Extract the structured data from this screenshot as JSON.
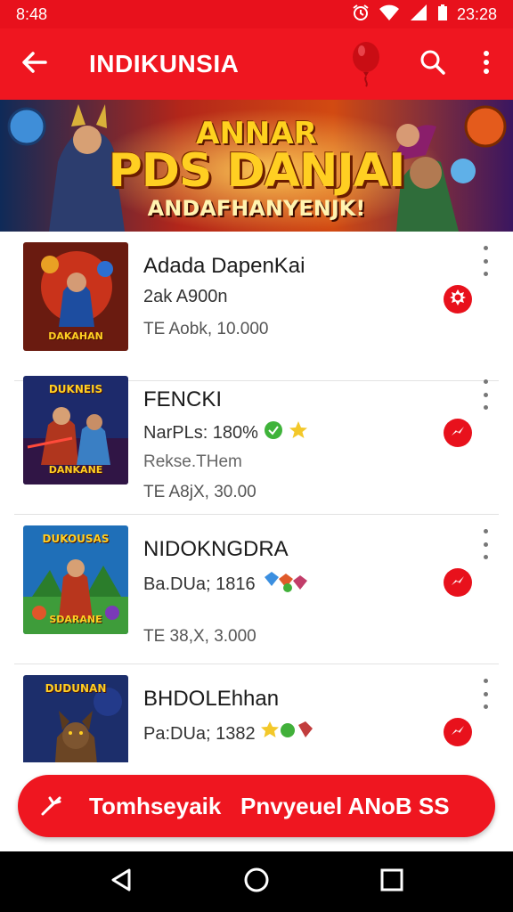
{
  "status": {
    "time": "8:48",
    "clock": "23:28"
  },
  "app_bar": {
    "title": "INDIKUNSIA"
  },
  "banner": {
    "line1": "ANNAR",
    "line2": "PDS DANJAI",
    "line3": "ANDAFHANYENJK!"
  },
  "items": [
    {
      "title": "Adada DapenKai",
      "meta1": "2ak A900n",
      "meta2": "",
      "price": "TE Aobk, 10.000",
      "thumb_top": "",
      "thumb_bottom": "DAKAHAN",
      "colors": [
        "#6a1b10",
        "#c9331b",
        "#1d1030"
      ]
    },
    {
      "title": "FENCKI",
      "meta1": "NarPLs: 180%",
      "meta2": "Rekse.THem",
      "price": "TE A8jX, 30.00",
      "thumb_top": "DUKNEIS",
      "thumb_bottom": "DANKANE",
      "colors": [
        "#1d2a6b",
        "#b0361e",
        "#301545"
      ]
    },
    {
      "title": "NIDOKNGDRA",
      "meta1": "Ba.DUa; 1816",
      "meta2": "",
      "price": "TE 38,X, 3.000",
      "thumb_top": "DUKOUSAS",
      "thumb_bottom": "SDARANE",
      "colors": [
        "#1f6fb8",
        "#3e9c3a",
        "#b8361d"
      ]
    },
    {
      "title": "BHDOLEhhan",
      "meta1": "Pa:DUa; 1382",
      "meta2": "",
      "price": "",
      "thumb_top": "DUDUNAN",
      "thumb_bottom": "",
      "colors": [
        "#1c2e6b",
        "#6b4524",
        "#233a8a"
      ]
    }
  ],
  "cta": {
    "label": "Tomhseyaik   Pnvyeuel ANoB SS"
  },
  "accent": "#ef1620",
  "icons": {
    "back": "arrow-left-icon",
    "search": "search-icon",
    "more": "more-vert-icon",
    "balloon": "balloon-icon",
    "badge": "flash-icon"
  }
}
